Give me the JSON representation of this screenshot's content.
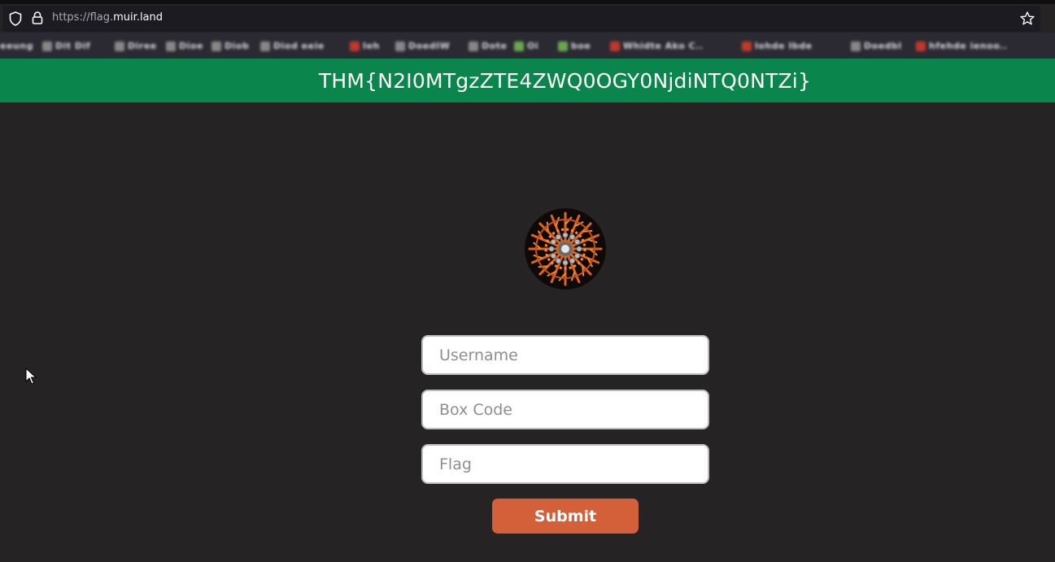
{
  "browser": {
    "url_prefix": "https://flag.",
    "url_domain": "muir.land",
    "bookmarks": [
      {
        "label": "eeung",
        "color": "#888888"
      },
      {
        "label": "Dit Dif",
        "color": "#888888"
      },
      {
        "label": "Diree",
        "color": "#888888"
      },
      {
        "label": "Dioe",
        "color": "#888888"
      },
      {
        "label": "Diob",
        "color": "#888888"
      },
      {
        "label": "Diod eeie",
        "color": "#888888"
      },
      {
        "label": "Ieh",
        "color": "#c0392b"
      },
      {
        "label": "DoedIW",
        "color": "#888888"
      },
      {
        "label": "Dote",
        "color": "#888888"
      },
      {
        "label": "Oi",
        "color": "#6aa84f"
      },
      {
        "label": "boe",
        "color": "#6aa84f"
      },
      {
        "label": "Whidte Ako C..",
        "color": "#c0392b"
      },
      {
        "label": "lohde Ibde",
        "color": "#c0392b"
      },
      {
        "label": "Doedbl",
        "color": "#888888"
      },
      {
        "label": "hfehde ienoo..",
        "color": "#c0392b"
      }
    ]
  },
  "page": {
    "flag": "THM{N2I0MTgzZTE4ZWQ0OGY0NjdiNTQ0NTZi}",
    "username_placeholder": "Username",
    "boxcode_placeholder": "Box Code",
    "flag_placeholder": "Flag",
    "submit_label": "Submit"
  },
  "colors": {
    "banner": "#0a854b",
    "background": "#252324",
    "submit": "#d4603a"
  },
  "icons": {
    "shield": "shield-icon",
    "lock": "lock-icon",
    "star": "bookmark-star-icon",
    "logo": "mandala-logo"
  }
}
